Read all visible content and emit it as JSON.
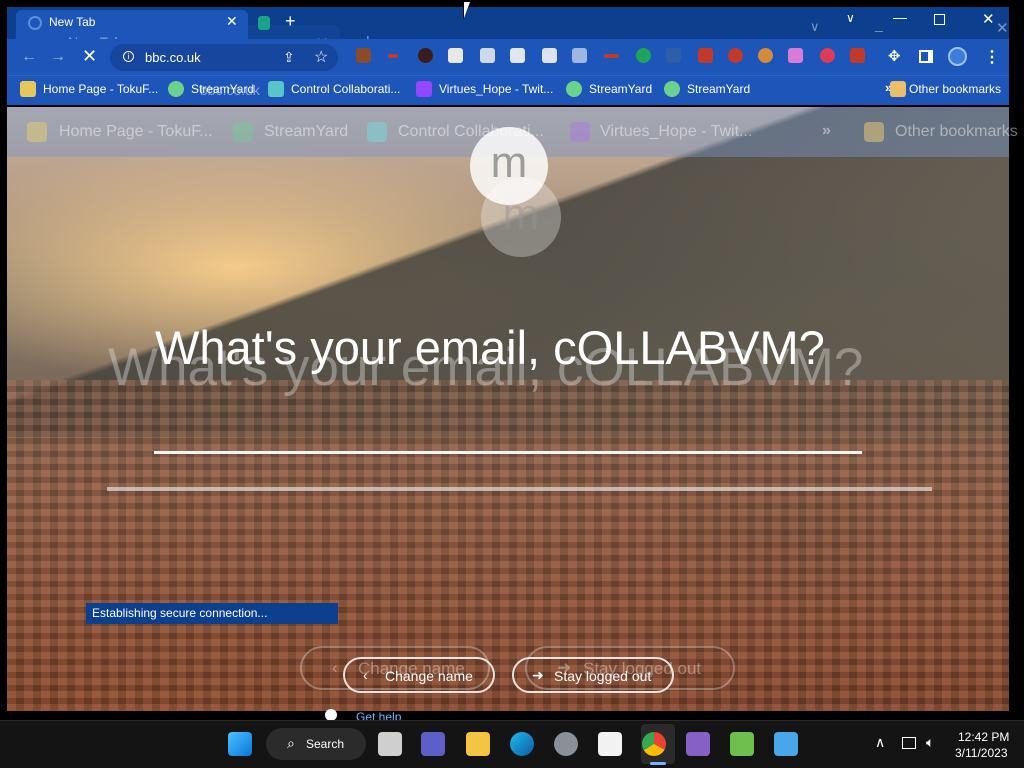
{
  "browser": {
    "tab_title": "New Tab",
    "url": "bbc.co.uk",
    "accent": "#1d56b8",
    "tabstrip_color": "#0d3f8f"
  },
  "ghost_browser": {
    "tab_title": "New Tab",
    "url": "bbc.co.uk"
  },
  "bookmarks": [
    {
      "label": "Home Page - TokuF...",
      "icon": "tokufest-icon"
    },
    {
      "label": "StreamYard",
      "icon": "streamyard-icon"
    },
    {
      "label": "Control Collaborati...",
      "icon": "monitor-icon"
    },
    {
      "label": "Virtues_Hope - Twit...",
      "icon": "twitch-icon"
    },
    {
      "label": "StreamYard",
      "icon": "streamyard-icon"
    },
    {
      "label": "StreamYard",
      "icon": "streamyard-icon"
    }
  ],
  "other_bookmarks": "Other bookmarks",
  "ghost_bookmarks": [
    {
      "label": "Home Page - TokuF..."
    },
    {
      "label": "StreamYard"
    },
    {
      "label": "Control Collaborati..."
    },
    {
      "label": "Virtues_Hope - Twit..."
    }
  ],
  "ghost_other_bookmarks": "Other bookmarks",
  "login": {
    "avatar_letter": "m",
    "heading": "What's your email, cOLLABVM?",
    "change_name": "Change name",
    "stay_logged_out": "Stay logged out",
    "get_help": "Get help"
  },
  "status_toast": "Establishing secure connection...",
  "taskbar": {
    "search_label": "Search",
    "time": "12:42 PM",
    "date": "3/11/2023"
  }
}
